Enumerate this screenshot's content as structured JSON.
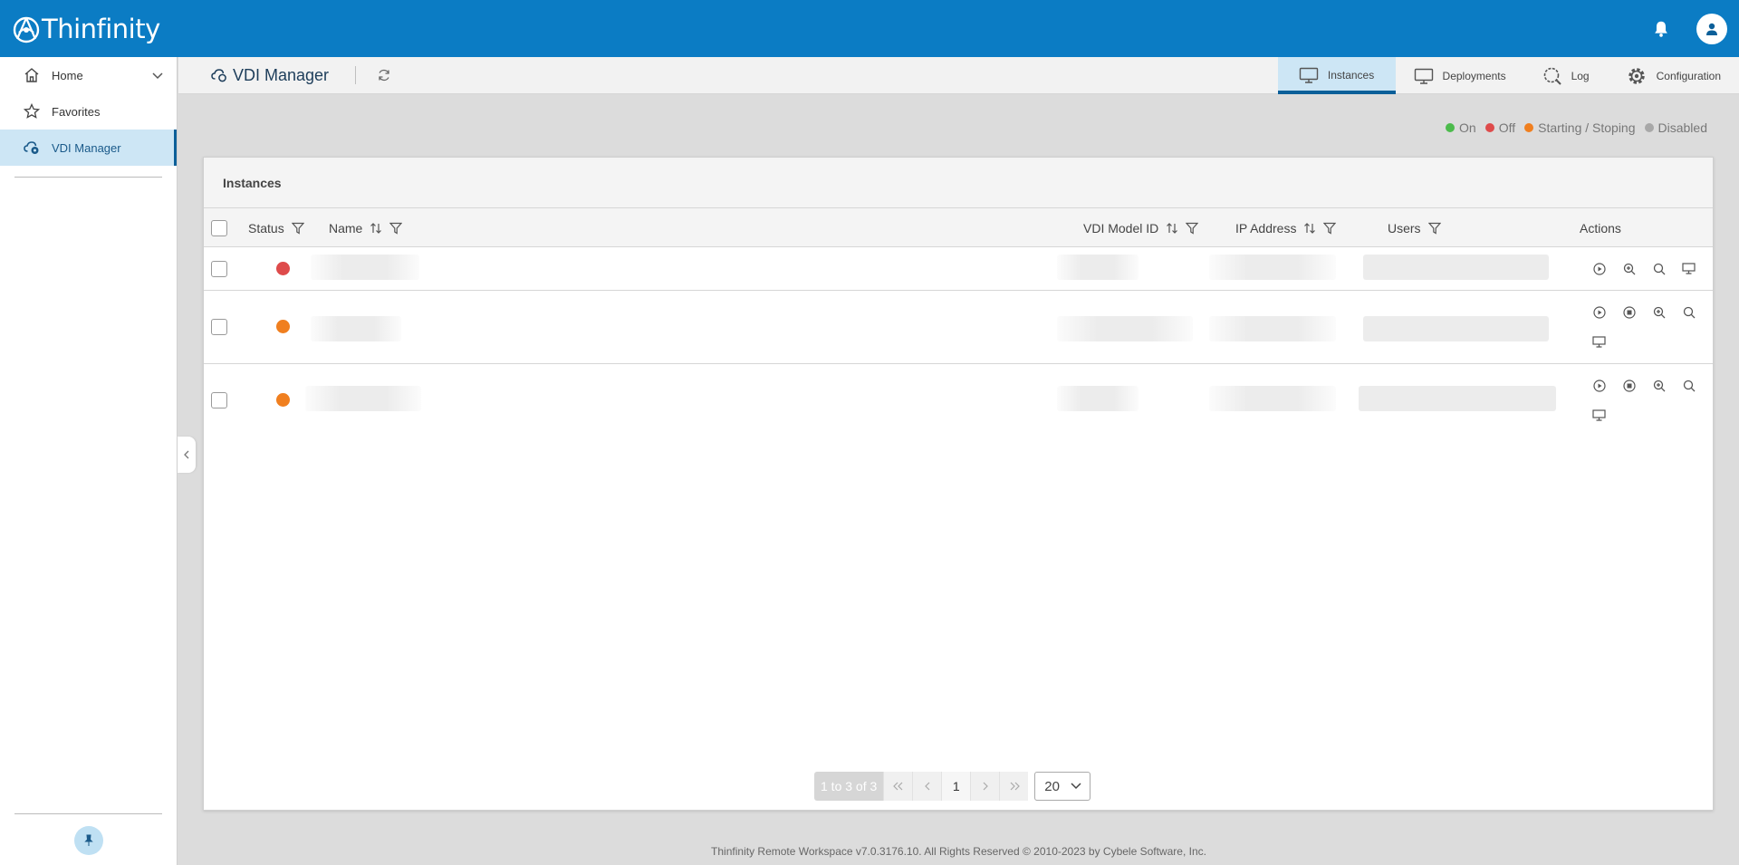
{
  "app": {
    "logo_text": "Thinfinity"
  },
  "header": {
    "icons": [
      "bell-icon",
      "user-icon"
    ]
  },
  "sidebar": {
    "items": [
      {
        "label": "Home",
        "icon": "home-icon"
      },
      {
        "label": "Favorites",
        "icon": "star-icon"
      },
      {
        "label": "VDI Manager",
        "icon": "vdi-cloud-icon"
      }
    ]
  },
  "page": {
    "title": "VDI Manager",
    "tabs": [
      {
        "label": "Instances",
        "icon": "monitor-icon"
      },
      {
        "label": "Deployments",
        "icon": "monitor-icon"
      },
      {
        "label": "Log",
        "icon": "log-search-icon"
      },
      {
        "label": "Configuration",
        "icon": "gear-icon"
      }
    ]
  },
  "legend": [
    {
      "label": "On",
      "color": "#4cbb4c"
    },
    {
      "label": "Off",
      "color": "#de4b4b"
    },
    {
      "label": "Starting / Stoping",
      "color": "#f07f1f"
    },
    {
      "label": "Disabled",
      "color": "#a8a8a8"
    }
  ],
  "table": {
    "title": "Instances",
    "columns": {
      "status": "Status",
      "name": "Name",
      "vdi_model_id": "VDI Model ID",
      "ip_address": "IP Address",
      "users": "Users",
      "actions": "Actions"
    },
    "rows": [
      {
        "status_color": "#de4b4b",
        "actions": [
          "play",
          "zoom-in",
          "search",
          "monitor"
        ]
      },
      {
        "status_color": "#f07f1f",
        "actions": [
          "play",
          "stop",
          "zoom-in",
          "search",
          "monitor"
        ]
      },
      {
        "status_color": "#f07f1f",
        "actions": [
          "play",
          "stop",
          "zoom-in",
          "search",
          "monitor"
        ]
      }
    ]
  },
  "pagination": {
    "info": "1 to 3 of 3",
    "current_page": "1",
    "page_size": "20"
  },
  "footer": {
    "text": "Thinfinity Remote Workspace v7.0.3176.10. All Rights Reserved © 2010-2023 by Cybele Software, Inc."
  }
}
